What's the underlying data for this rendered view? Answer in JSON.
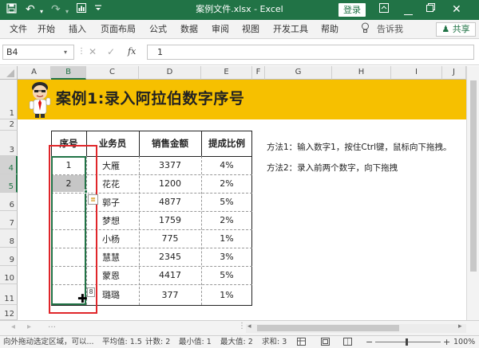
{
  "titlebar": {
    "title": "案例文件.xlsx  -  Excel",
    "login": "登录",
    "bg": "#217346"
  },
  "tabs": [
    "文件",
    "开始",
    "插入",
    "页面布局",
    "公式",
    "数据",
    "审阅",
    "视图",
    "开发工具",
    "帮助"
  ],
  "tell_me": "告诉我",
  "share": "共享",
  "formula_bar": {
    "name_box": "B4",
    "value": "1",
    "fx": "fx"
  },
  "columns": [
    "A",
    "B",
    "C",
    "D",
    "E",
    "F",
    "G",
    "H",
    "I",
    "J"
  ],
  "rows": [
    "1",
    "2",
    "3",
    "4",
    "5",
    "6",
    "7",
    "8",
    "9",
    "10",
    "11",
    "12"
  ],
  "banner": {
    "title": "案例1:录入阿拉伯数字序号",
    "color": "#f6c000"
  },
  "table": {
    "headers": [
      "序号",
      "业务员",
      "销售金额",
      "提成比例"
    ],
    "rows": [
      [
        "1",
        "大雁",
        "3377",
        "4%"
      ],
      [
        "2",
        "花花",
        "1200",
        "2%"
      ],
      [
        "",
        "郭子",
        "4877",
        "5%"
      ],
      [
        "",
        "梦想",
        "1759",
        "2%"
      ],
      [
        "",
        "小杨",
        "775",
        "1%"
      ],
      [
        "",
        "慧慧",
        "2345",
        "3%"
      ],
      [
        "",
        "蒙恩",
        "4417",
        "5%"
      ],
      [
        "",
        "璐璐",
        "377",
        "1%"
      ]
    ]
  },
  "notes": [
    "方法1：输入数字1，按住Ctrl键，鼠标向下拖拽。",
    "方法2：录入前两个数字，向下拖拽"
  ],
  "drag_tooltip": "8",
  "status": {
    "message": "向外拖动选定区域，可以...",
    "average": "平均值: 1.5",
    "count": "计数: 2",
    "min": "最小值: 1",
    "max": "最大值: 2",
    "sum": "求和: 3",
    "zoom": "100%"
  }
}
